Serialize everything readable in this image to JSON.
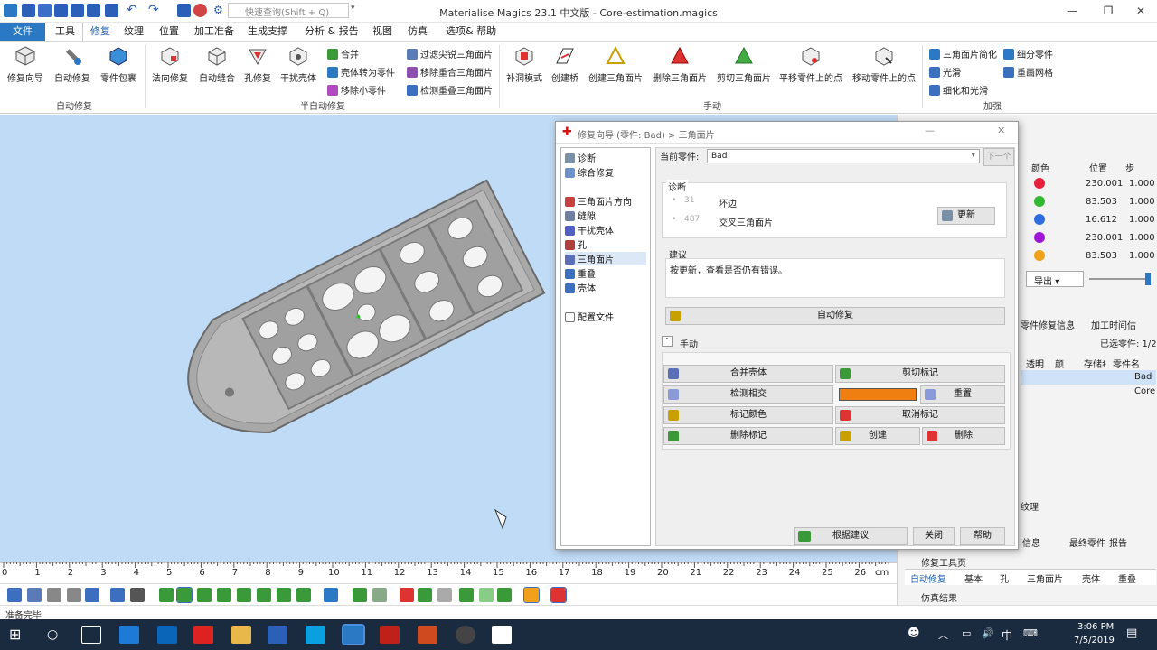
{
  "app": {
    "title": "Materialise Magics 23.1 中文版 - Core-estimation.magics",
    "search_placeholder": "快速查询(Shift + Q)"
  },
  "menu": [
    "文件",
    "工具",
    "修复",
    "纹理",
    "位置",
    "加工准备",
    "生成支撑",
    "分析 & 报告",
    "视图",
    "仿真",
    "选项& 帮助"
  ],
  "ribbon": {
    "auto_repair": {
      "buttons": [
        "修复向导",
        "自动修复",
        "零件包裹"
      ],
      "label": "自动修复"
    },
    "semi_auto": {
      "buttons": [
        "法向修复",
        "自动缝合",
        "孔修复",
        "干扰壳体"
      ],
      "small": [
        "合并",
        "壳体转为零件",
        "移除小零件",
        "过滤尖锐三角面片",
        "移除重合三角面片",
        "检测重叠三角面片"
      ],
      "label": "半自动修复"
    },
    "manual": {
      "buttons": [
        "补洞模式",
        "创建桥",
        "创建三角面片",
        "删除三角面片",
        "剪切三角面片",
        "平移零件上的点",
        "移动零件上的点"
      ],
      "label": "手动"
    },
    "enhance": {
      "small": [
        "三角面片简化",
        "细分零件",
        "光滑",
        "重画网格",
        "细化和光滑"
      ],
      "label": "加强"
    }
  },
  "ruler": {
    "numbers": [
      "0",
      "1",
      "2",
      "3",
      "4",
      "5",
      "6",
      "7",
      "8",
      "9",
      "10",
      "11",
      "12",
      "13",
      "14",
      "15",
      "16",
      "17",
      "18",
      "19",
      "20",
      "21",
      "22",
      "23",
      "24",
      "25",
      "26"
    ],
    "unit": "cm"
  },
  "status": "准备完毕",
  "taskbar": {
    "time": "3:06 PM",
    "date": "7/5/2019",
    "ime": "中"
  },
  "right_panel": {
    "header": [
      "颜色",
      "位置",
      "步"
    ],
    "rows": [
      {
        "color": "#e8213a",
        "position": "230.001",
        "step": "1.000"
      },
      {
        "color": "#33b833",
        "position": "83.503",
        "step": "1.000"
      },
      {
        "color": "#2e6de0",
        "position": "16.612",
        "step": "1.000"
      },
      {
        "color": "#a117d8",
        "position": "230.001",
        "step": "1.000"
      },
      {
        "color": "#f0a01a",
        "position": "83.503",
        "step": "1.000"
      }
    ],
    "export_label": "导出",
    "tabs_top": [
      "零件修复信息",
      "加工时间估"
    ],
    "selected": "已选零件: 1/2",
    "parts_header": [
      "透明",
      "颜",
      "存储ｷ",
      "零件名"
    ],
    "parts": [
      "Bad",
      "Core"
    ],
    "texture": "纹理",
    "lower_tabs": [
      "信息",
      "最终零件",
      "报告"
    ],
    "repair_toolbar": "修复工具页",
    "bottom_tabs": [
      "自动修复",
      "基本",
      "孔",
      "三角面片",
      "壳体",
      "重叠"
    ],
    "sim_result": "仿真结果"
  },
  "dialog": {
    "title": "修复向导 (零件: Bad) > 三角面片",
    "tree": [
      "诊断",
      "综合修复",
      "三角面片方向",
      "缝隙",
      "干扰壳体",
      "孔",
      "三角面片",
      "重叠",
      "壳体",
      "配置文件"
    ],
    "current_part_label": "当前零件:",
    "current_part_value": "Bad",
    "next_button": "下一个",
    "diag_title": "诊断",
    "diag_rows": [
      {
        "count": "31",
        "label": "坏边"
      },
      {
        "count": "487",
        "label": "交叉三角面片"
      }
    ],
    "update_button": "更新",
    "suggest_title": "建议",
    "suggest_text": "按更新，查看是否仍有错误。",
    "auto_fix_button": "自动修复",
    "manual_title": "手动",
    "manual_buttons": {
      "merge_shells": "合并壳体",
      "cut_mark": "剪切标记",
      "detect_intersect": "检测相交",
      "reset": "重置",
      "mark_color": "标记颜色",
      "unmark": "取消标记",
      "delete_mark": "删除标记",
      "create": "创建",
      "delete": "删除"
    },
    "swatch_color": "#f07f12",
    "follow_button": "根据建议",
    "close_button": "关闭",
    "help_button": "帮助"
  }
}
